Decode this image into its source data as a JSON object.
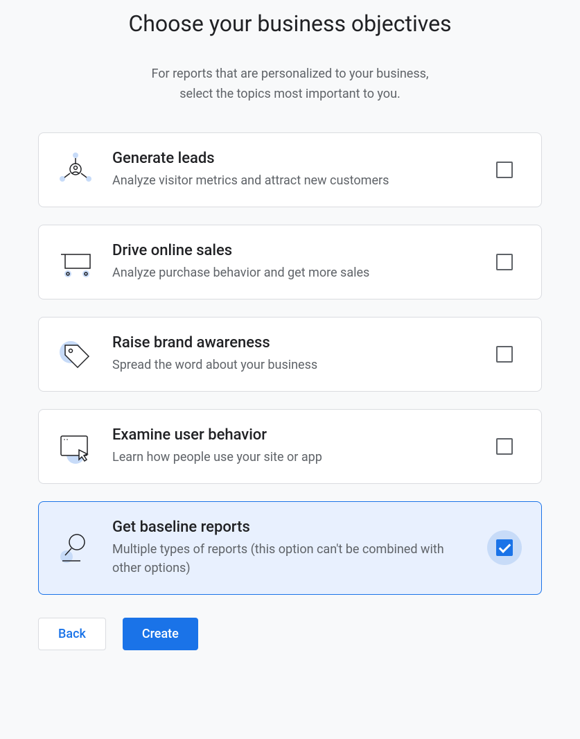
{
  "header": {
    "title": "Choose your business objectives",
    "subtitle_line1": "For reports that are personalized to your business,",
    "subtitle_line2": "select the topics most important to you."
  },
  "options": [
    {
      "id": "generate-leads",
      "title": "Generate leads",
      "description": "Analyze visitor metrics and attract new customers",
      "icon": "leads-icon",
      "selected": false
    },
    {
      "id": "drive-online-sales",
      "title": "Drive online sales",
      "description": "Analyze purchase behavior and get more sales",
      "icon": "cart-icon",
      "selected": false
    },
    {
      "id": "raise-brand-awareness",
      "title": "Raise brand awareness",
      "description": "Spread the word about your business",
      "icon": "tag-icon",
      "selected": false
    },
    {
      "id": "examine-user-behavior",
      "title": "Examine user behavior",
      "description": "Learn how people use your site or app",
      "icon": "behavior-icon",
      "selected": false
    },
    {
      "id": "get-baseline-reports",
      "title": "Get baseline reports",
      "description": "Multiple types of reports (this option can't be combined with other options)",
      "icon": "reports-icon",
      "selected": true
    }
  ],
  "footer": {
    "back_label": "Back",
    "create_label": "Create"
  }
}
